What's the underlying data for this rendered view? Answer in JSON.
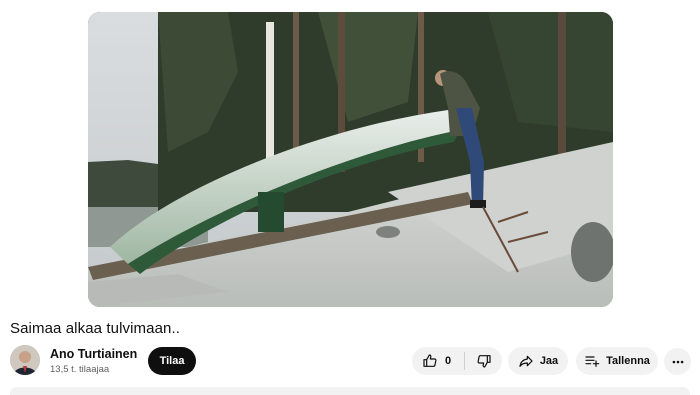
{
  "video": {
    "title": "Saimaa alkaa tulvimaan.."
  },
  "channel": {
    "name": "Ano Turtiainen",
    "subscribers": "13,5 t. tilaajaa",
    "subscribe_label": "Tilaa"
  },
  "actions": {
    "like_count": "0",
    "share_label": "Jaa",
    "save_label": "Tallenna"
  },
  "icons": {
    "like": "thumbs-up-icon",
    "dislike": "thumbs-down-icon",
    "share": "share-arrow-icon",
    "save": "playlist-add-icon",
    "more": "more-horizontal-icon"
  }
}
